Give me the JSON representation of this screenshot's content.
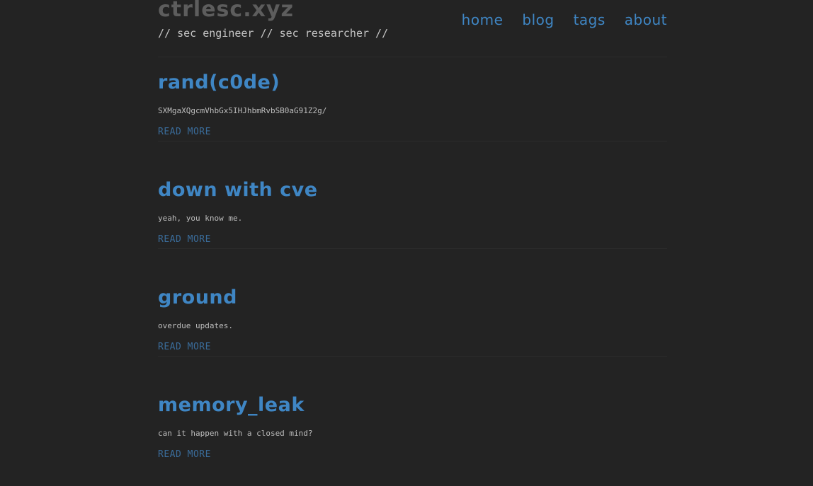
{
  "site": {
    "title": "ctrlesc.xyz",
    "tagline": "// sec engineer // sec researcher //"
  },
  "nav": {
    "items": [
      {
        "label": "home"
      },
      {
        "label": "blog"
      },
      {
        "label": "tags"
      },
      {
        "label": "about"
      }
    ]
  },
  "posts": [
    {
      "title": "rand(c0de)",
      "excerpt": "SXMgaXQgcmVhbGx5IHJhbmRvbSB0aG91Z2g/",
      "read_more": "READ MORE"
    },
    {
      "title": "down with cve",
      "excerpt": "yeah, you know me.",
      "read_more": "READ MORE"
    },
    {
      "title": "ground",
      "excerpt": "overdue updates.",
      "read_more": "READ MORE"
    },
    {
      "title": "memory_leak",
      "excerpt": "can it happen with a closed mind?",
      "read_more": "READ MORE"
    }
  ],
  "colors": {
    "background": "#232323",
    "accent": "#3f86c4",
    "site_title": "#5d5d5d",
    "text": "#c4c4c4"
  }
}
